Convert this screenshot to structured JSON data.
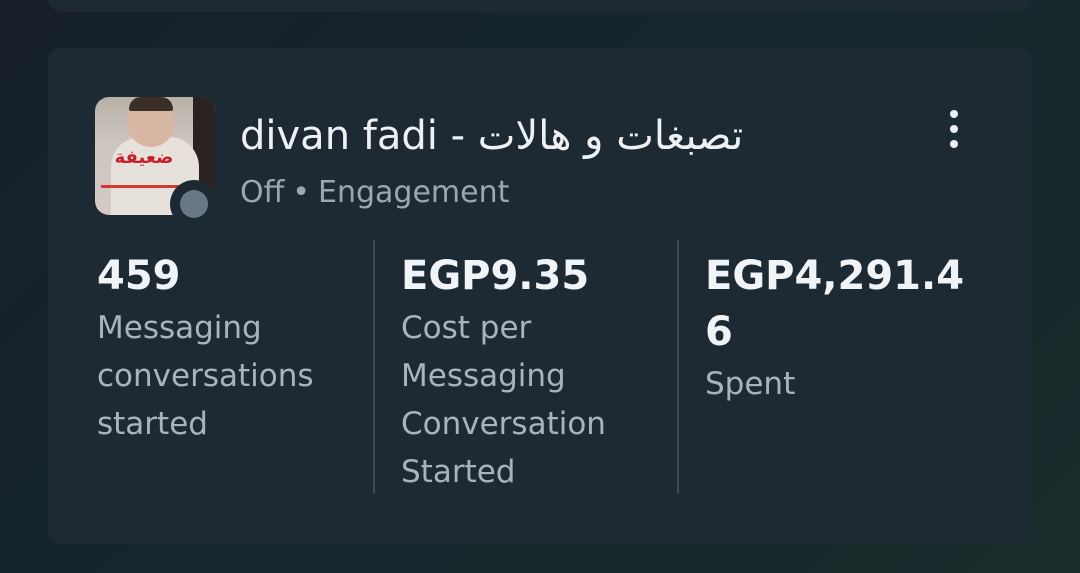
{
  "campaign": {
    "title": "divan fadi - تصبغات و هالات",
    "status": "Off",
    "separator": "•",
    "objective": "Engagement",
    "thumbnail_text": "ضعيفة",
    "status_color": "#6a7886",
    "menu_icon": "more-vertical-icon"
  },
  "metrics": [
    {
      "value": "459",
      "label": "Messaging conversations started"
    },
    {
      "value": "EGP9.35",
      "label": "Cost per Messaging Conversation Started"
    },
    {
      "value": "EGP4,291.46",
      "label": "Spent"
    }
  ]
}
